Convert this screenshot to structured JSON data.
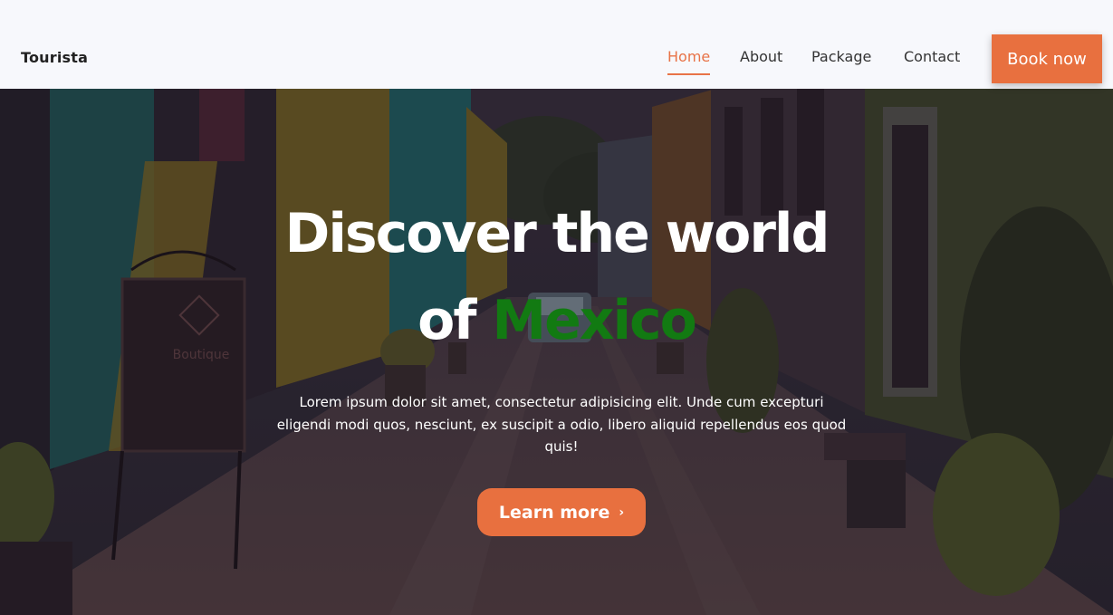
{
  "brand": {
    "name": "Tourista"
  },
  "nav": {
    "items": [
      {
        "label": "Home",
        "active": true
      },
      {
        "label": "About",
        "active": false
      },
      {
        "label": "Package",
        "active": false
      },
      {
        "label": "Contact",
        "active": false
      }
    ],
    "cta_label": "Book now"
  },
  "hero": {
    "title_line1": "Discover the world",
    "title_prefix": "of",
    "title_accent": "Mexico",
    "description": "Lorem ipsum dolor sit amet, consectetur adipisicing elit. Unde cum excepturi eligendi modi quos, nesciunt, ex suscipit a odio, libero aliquid repellendus eos quod quis!",
    "cta_label": "Learn more",
    "cta_icon": "chevron-right-icon",
    "image_alt_sign": "Boutique"
  },
  "colors": {
    "accent": "#e8703f",
    "title_accent": "#127a12",
    "header_bg": "#f7f8fc"
  }
}
